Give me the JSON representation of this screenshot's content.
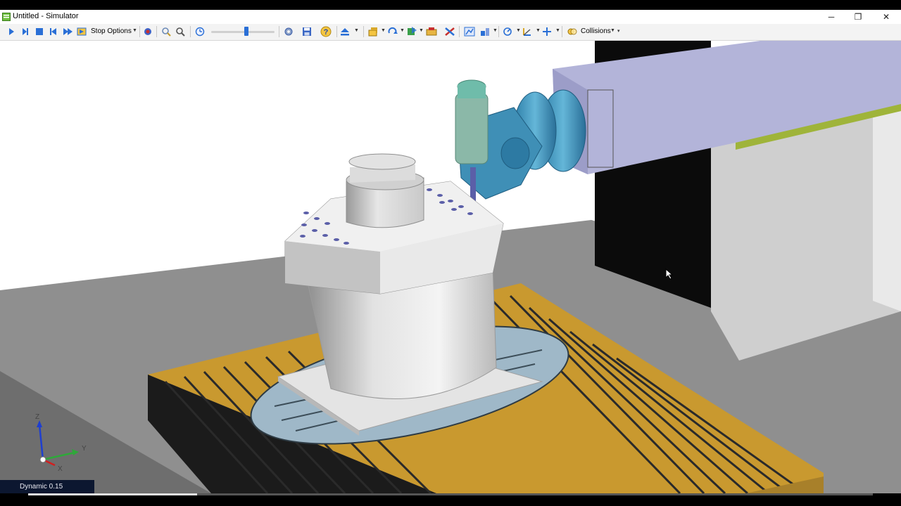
{
  "window": {
    "title": "Untitled - Simulator",
    "controls": {
      "minimize": "─",
      "restore": "❐",
      "close": "✕"
    }
  },
  "toolbar": {
    "stop_options_label": "Stop Options",
    "collisions_label": "Collisions",
    "speed_slider_level": 0.55,
    "icons": [
      "play-icon",
      "step-icon",
      "stop-icon",
      "rewind-icon",
      "forward-icon",
      "goto-icon",
      "record-icon",
      "zoom-icon",
      "zoom-fit-icon",
      "timer-icon",
      "settings-icon",
      "save-icon",
      "help-icon",
      "eject-icon",
      "machine-icon",
      "rotate-icon",
      "color-icon",
      "palette-icon",
      "tool-icon",
      "view-icon",
      "section-icon",
      "measure-icon",
      "axis-icon",
      "ruler-icon",
      "collision-icon"
    ]
  },
  "viewport": {
    "axes": {
      "z": "Z",
      "y": "Y",
      "x": "X"
    },
    "status": "Dynamic 0.15"
  },
  "playback": {
    "progress": 0.2
  },
  "colors": {
    "table_slot": "#c9992f",
    "rotary": "#9fb8c8",
    "spindle_head": "#4c9cc0",
    "beam": "#b0b2d8",
    "accent": "#2a6fd6"
  }
}
